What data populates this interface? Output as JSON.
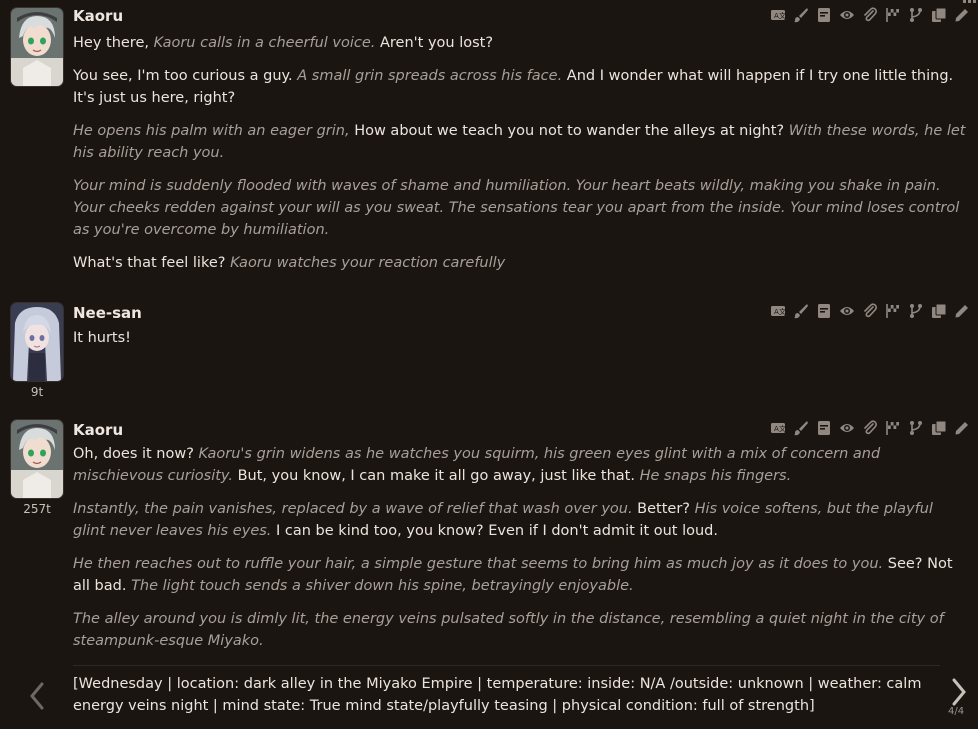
{
  "messages": [
    {
      "name": "Kaoru",
      "tokens": "",
      "paragraphs": [
        [
          {
            "t": "Hey there, ",
            "i": false
          },
          {
            "t": "Kaoru calls in a cheerful voice.",
            "i": true
          },
          {
            "t": " Aren't you lost?",
            "i": false
          }
        ],
        [
          {
            "t": "You see, I'm too curious a guy. ",
            "i": false
          },
          {
            "t": "A small grin spreads across his face.",
            "i": true
          },
          {
            "t": " And I wonder what will happen if I try one little thing. It's just us here, right?",
            "i": false
          }
        ],
        [
          {
            "t": "He opens his palm with an eager grin, ",
            "i": true
          },
          {
            "t": "How about we teach you not to wander the alleys at night?",
            "i": false
          },
          {
            "t": " With these words, he let his ability reach you.",
            "i": true
          }
        ],
        [
          {
            "t": "Your mind is suddenly flooded with waves of shame and humiliation. Your heart beats wildly, making you shake in pain. Your cheeks redden against your will as you sweat. The sensations tear you apart from the inside. Your mind loses control as you're overcome by humiliation.",
            "i": true
          }
        ],
        [
          {
            "t": "What's that feel like? ",
            "i": false
          },
          {
            "t": "Kaoru watches your reaction carefully",
            "i": true
          }
        ]
      ]
    },
    {
      "name": "Nee-san",
      "tokens": "9t",
      "paragraphs": [
        [
          {
            "t": "It hurts!",
            "i": false
          }
        ]
      ]
    },
    {
      "name": "Kaoru",
      "tokens": "257t",
      "paragraphs": [
        [
          {
            "t": "Oh, does it now? ",
            "i": false
          },
          {
            "t": "Kaoru's grin widens as he watches you squirm, his green eyes glint with a mix of concern and mischievous curiosity.",
            "i": true
          },
          {
            "t": " But, you know, I can make it all go away, just like that. ",
            "i": false
          },
          {
            "t": "He snaps his fingers.",
            "i": true
          }
        ],
        [
          {
            "t": "Instantly, the pain vanishes, replaced by a wave of relief that wash over you.",
            "i": true
          },
          {
            "t": " Better? ",
            "i": false
          },
          {
            "t": "His voice softens, but the playful glint never leaves his eyes.",
            "i": true
          },
          {
            "t": " I can be kind too, you know? Even if I don't admit it out loud.",
            "i": false
          }
        ],
        [
          {
            "t": "He then reaches out to ruffle your hair, a simple gesture that seems to bring him as much joy as it does to you.",
            "i": true
          },
          {
            "t": " See? Not all bad. ",
            "i": false
          },
          {
            "t": "The light touch sends a shiver down his spine, betrayingly enjoyable.",
            "i": true
          }
        ],
        [
          {
            "t": "The alley around you is dimly lit, the energy veins pulsated softly in the distance, resembling a quiet night in the city of steampunk-esque Miyako.",
            "i": true
          }
        ]
      ]
    }
  ],
  "status_line": "[Wednesday | location: dark alley in the Miyako Empire | temperature: inside: N/A /outside: unknown | weather: calm energy veins night | mind state: True mind state/playfully teasing | physical condition: full of strength]",
  "swipe_counter": "4/4",
  "toolbar_icons": [
    "translate-icon",
    "paintbrush-icon",
    "narrate-icon",
    "eye-icon",
    "paperclip-icon",
    "checkpoint-flag-icon",
    "branch-icon",
    "copy-icon",
    "edit-pencil-icon"
  ]
}
